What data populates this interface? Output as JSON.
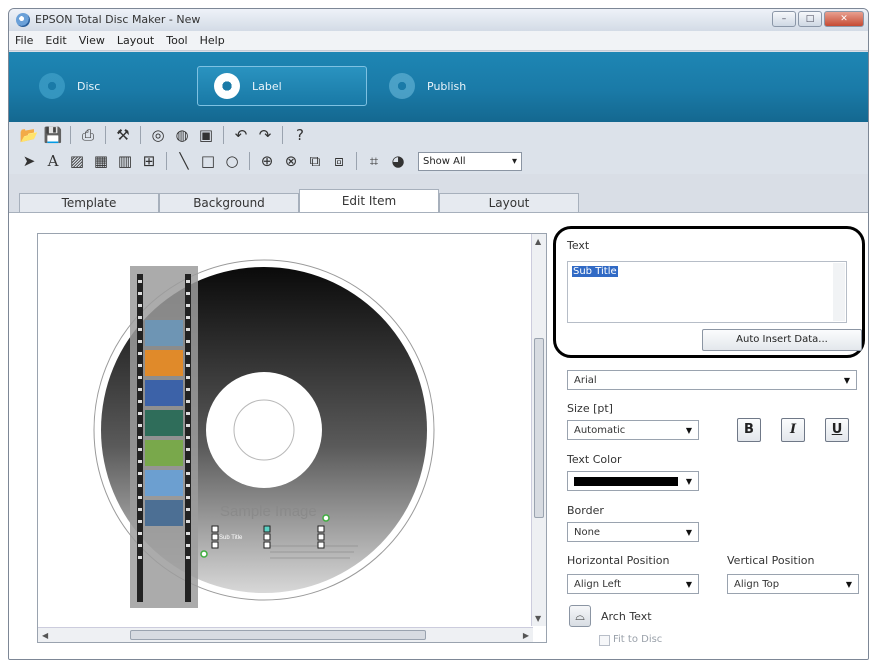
{
  "window": {
    "title": "EPSON Total Disc Maker - New",
    "controls": {
      "minimize": "–",
      "maximize": "□",
      "close": "✕"
    }
  },
  "menu": [
    "File",
    "Edit",
    "View",
    "Layout",
    "Tool",
    "Help"
  ],
  "modes": [
    {
      "label": "Disc",
      "icon": "disc-icon"
    },
    {
      "label": "Label",
      "icon": "label-disc-icon",
      "active": true
    },
    {
      "label": "Publish",
      "icon": "publish-icon"
    }
  ],
  "toolbar": {
    "view_filter": "Show All"
  },
  "tabs": [
    {
      "label": "Template"
    },
    {
      "label": "Background"
    },
    {
      "label": "Edit Item",
      "active": true
    },
    {
      "label": "Layout"
    }
  ],
  "canvas": {
    "sample_image_text": "Sample Image",
    "selected_text": "Sub Title"
  },
  "panel": {
    "text_label": "Text",
    "text_value": "Sub Title",
    "auto_insert_button": "Auto Insert Data...",
    "font_value": "Arial",
    "size_label": "Size [pt]",
    "size_value": "Automatic",
    "bold": "B",
    "italic": "I",
    "underline": "U",
    "text_color_label": "Text Color",
    "text_color": "#000000",
    "border_label": "Border",
    "border_value": "None",
    "hpos_label": "Horizontal Position",
    "hpos_value": "Align Left",
    "vpos_label": "Vertical Position",
    "vpos_value": "Align Top",
    "arch_text_label": "Arch Text",
    "fit_to_disc_label": "Fit to Disc",
    "fit_to_disc_checked": false
  },
  "colors": {
    "mode_band": "#1a7aa7",
    "highlight_outline": "#000000"
  }
}
